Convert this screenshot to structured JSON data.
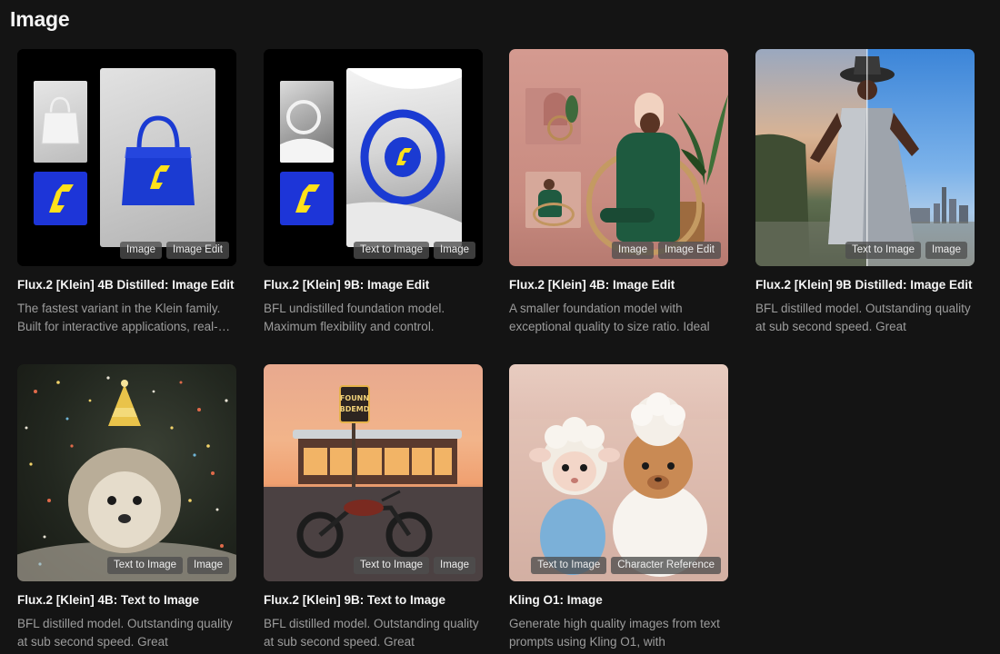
{
  "section": {
    "title": "Image"
  },
  "cards": [
    {
      "title": "Flux.2 [Klein] 4B Distilled: Image Edit",
      "description": "The fastest variant in the Klein family. Built for interactive applications, real-time previews.",
      "tags": [
        "Image",
        "Image Edit"
      ]
    },
    {
      "title": "Flux.2 [Klein] 9B: Image Edit",
      "description": "BFL undistilled foundation model. Maximum flexibility and control.",
      "tags": [
        "Text to Image",
        "Image"
      ]
    },
    {
      "title": "Flux.2 [Klein] 4B: Image Edit",
      "description": "A smaller foundation model with exceptional quality to size ratio. Ideal",
      "tags": [
        "Image",
        "Image Edit"
      ]
    },
    {
      "title": "Flux.2 [Klein] 9B Distilled: Image Edit",
      "description": "BFL distilled model. Outstanding quality at sub second speed. Great",
      "tags": [
        "Text to Image",
        "Image"
      ]
    },
    {
      "title": "Flux.2 [Klein] 4B: Text to Image",
      "description": "BFL distilled model. Outstanding quality at sub second speed. Great",
      "tags": [
        "Text to Image",
        "Image"
      ]
    },
    {
      "title": "Flux.2 [Klein] 9B: Text to Image",
      "description": "BFL distilled model. Outstanding quality at sub second speed. Great",
      "tags": [
        "Text to Image",
        "Image"
      ]
    },
    {
      "title": "Kling O1: Image",
      "description": "Generate high quality images from text prompts using Kling O1, with",
      "tags": [
        "Text to Image",
        "Character Reference"
      ]
    }
  ],
  "images": [
    {
      "icon": "handbag-edit-image"
    },
    {
      "icon": "car-steering-wheel-image"
    },
    {
      "icon": "woman-in-chair-image"
    },
    {
      "icon": "fashion-skyline-image"
    },
    {
      "icon": "hedgehog-party-hat-image"
    },
    {
      "icon": "diner-motorcycle-image"
    },
    {
      "icon": "sheep-and-capybara-image"
    }
  ],
  "colors": {
    "background": "#141414",
    "logo_blue": "#1d35d8",
    "logo_yellow": "#ffe11a",
    "bag_blue": "#1b3bd2",
    "tag_bg": "#4e4e4e"
  }
}
